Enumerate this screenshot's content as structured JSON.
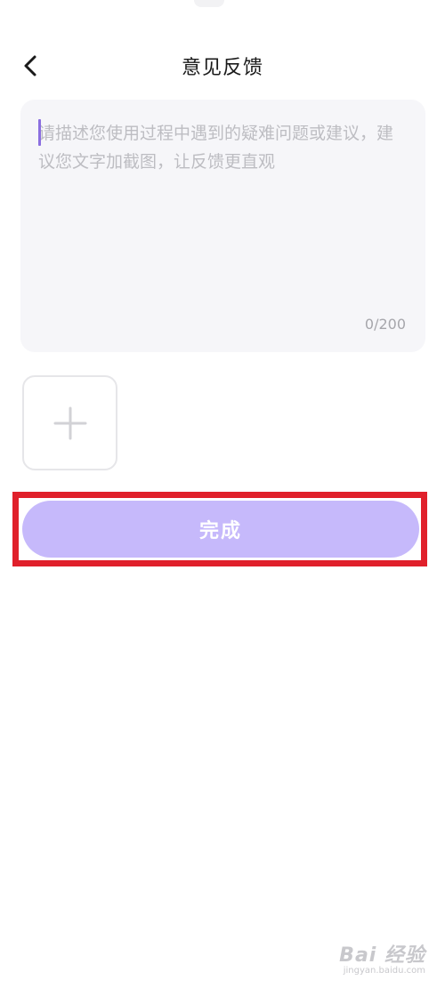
{
  "header": {
    "title": "意见反馈",
    "back_icon": "chevron-left-icon"
  },
  "feedback": {
    "placeholder": "请描述您使用过程中遇到的疑难问题或建议，建议您文字加截图，让反馈更直观",
    "value": "",
    "counter": "0/200",
    "caret_color": "#8b6fe0"
  },
  "upload": {
    "icon": "plus-icon"
  },
  "actions": {
    "submit_label": "完成",
    "submit_color": "#c6b9fb",
    "highlight_color": "#e0202b"
  },
  "watermark": {
    "brand": "Bai 经验",
    "url": "jingyan.baidu.com"
  }
}
